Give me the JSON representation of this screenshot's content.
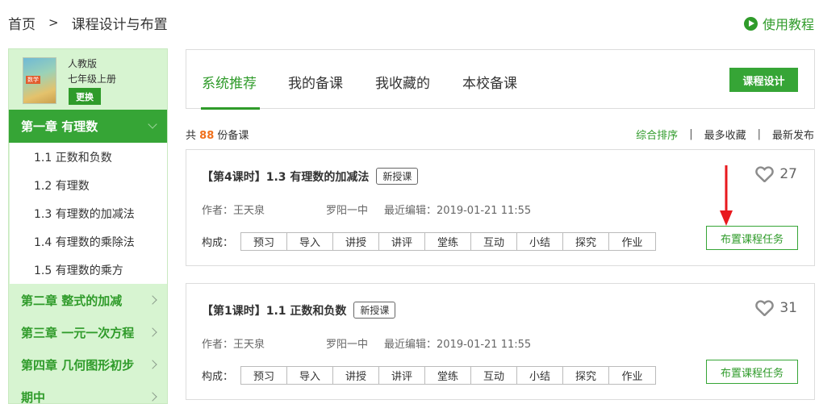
{
  "breadcrumb": {
    "home": "首页",
    "separator": ">",
    "current": "课程设计与布置"
  },
  "help": {
    "label": "使用教程",
    "icon": "play-circle-icon"
  },
  "sidebar": {
    "book": {
      "edition": "人教版",
      "grade": "七年级上册",
      "cover_tag": "数学",
      "change_label": "更换"
    },
    "active_chapter": "第一章 有理数",
    "lessons": [
      "1.1 正数和负数",
      "1.2 有理数",
      "1.3 有理数的加减法",
      "1.4 有理数的乘除法",
      "1.5 有理数的乘方"
    ],
    "chapters": [
      "第二章 整式的加减",
      "第三章 一元一次方程",
      "第四章 几何图形初步",
      "期中"
    ]
  },
  "tabs": [
    "系统推荐",
    "我的备课",
    "我收藏的",
    "本校备课"
  ],
  "design_button": "课程设计",
  "count": {
    "prefix": "共",
    "number": "88",
    "suffix": "份备课"
  },
  "sort": {
    "options": [
      "综合排序",
      "最多收藏",
      "最新发布"
    ],
    "separator": "|",
    "active": "综合排序"
  },
  "cards": [
    {
      "title": "【第4课时】1.3 有理数的加减法",
      "badge": "新授课",
      "likes": "27",
      "author": "作者：王天泉",
      "school": "罗阳一中",
      "edited": "最近编辑：2019-01-21 11:55",
      "composition_label": "构成：",
      "steps": [
        "预习",
        "导入",
        "讲授",
        "讲评",
        "堂练",
        "互动",
        "小结",
        "探究",
        "作业"
      ],
      "assign_label": "布置课程任务"
    },
    {
      "title": "【第1课时】1.1 正数和负数",
      "badge": "新授课",
      "likes": "31",
      "author": "作者：王天泉",
      "school": "罗阳一中",
      "edited": "最近编辑：2019-01-21 11:55",
      "composition_label": "构成：",
      "steps": [
        "预习",
        "导入",
        "讲授",
        "讲评",
        "堂练",
        "互动",
        "小结",
        "探究",
        "作业"
      ],
      "assign_label": "布置课程任务"
    }
  ],
  "colors": {
    "brand_green": "#2f9b2a",
    "sidebar_bg": "#d7f4d1",
    "count_orange": "#f0701c",
    "arrow_red": "#e8191e"
  }
}
